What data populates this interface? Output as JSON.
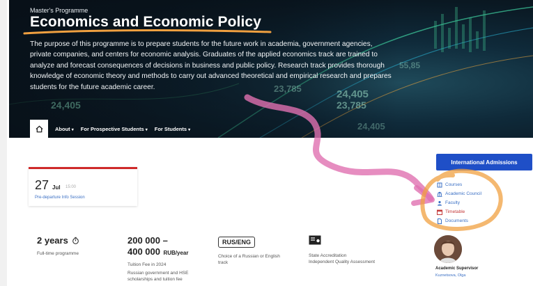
{
  "hero": {
    "eyebrow": "Master's Programme",
    "title": "Economics and Economic Policy",
    "description": "The purpose of this programme is to prepare students for the future work in academia, government agencies, private companies, and centers for economic analysis. Graduates of the applied economics track are trained to analyze and forecast consequences of decisions in business and public policy. Research track provides thorough knowledge of economic theory and methods to carry out advanced theoretical and empirical research and prepares students for the future academic career.",
    "background_numbers": [
      "24,405",
      "23,785",
      "24,405",
      "23,785",
      "55,85",
      "24,405"
    ]
  },
  "nav": {
    "home_icon": "home-icon",
    "items": [
      {
        "label": "About"
      },
      {
        "label": "For Prospective Students"
      },
      {
        "label": "For Students"
      }
    ]
  },
  "event": {
    "day": "27",
    "month": "Jul",
    "time": "15:00",
    "title": "Pre-departure Info Session"
  },
  "sidebar": {
    "admissions_label": "International Admissions",
    "links": [
      {
        "label": "Courses",
        "icon": "book-icon"
      },
      {
        "label": "Academic Council",
        "icon": "building-icon"
      },
      {
        "label": "Faculty",
        "icon": "people-icon"
      },
      {
        "label": "Timetable",
        "icon": "calendar-icon"
      },
      {
        "label": "Documents",
        "icon": "document-icon"
      }
    ]
  },
  "stats": {
    "duration": {
      "value": "2 years",
      "note": "Full-time programme"
    },
    "fee": {
      "value_line1": "200 000 –",
      "value_line2": "400 000",
      "unit": "RUB/year",
      "note": "Tuition Fee in 2024",
      "note2": "Russian government and HSE scholarships and tuition fee"
    },
    "language": {
      "value": "RUS/ENG",
      "note": "Choice of a Russian or English track"
    },
    "accreditation": {
      "note": "State Accreditation",
      "note2": "Independent Quality Assessment"
    }
  },
  "supervisor": {
    "role": "Academic Supervisor",
    "name": "Kuznetsova, Olga"
  },
  "colors": {
    "accent_blue": "#1f4fc7",
    "event_red": "#cf2a2a",
    "annotation_orange": "#f0a040",
    "annotation_pink": "#e070b0",
    "link_blue": "#3a6fc4"
  }
}
